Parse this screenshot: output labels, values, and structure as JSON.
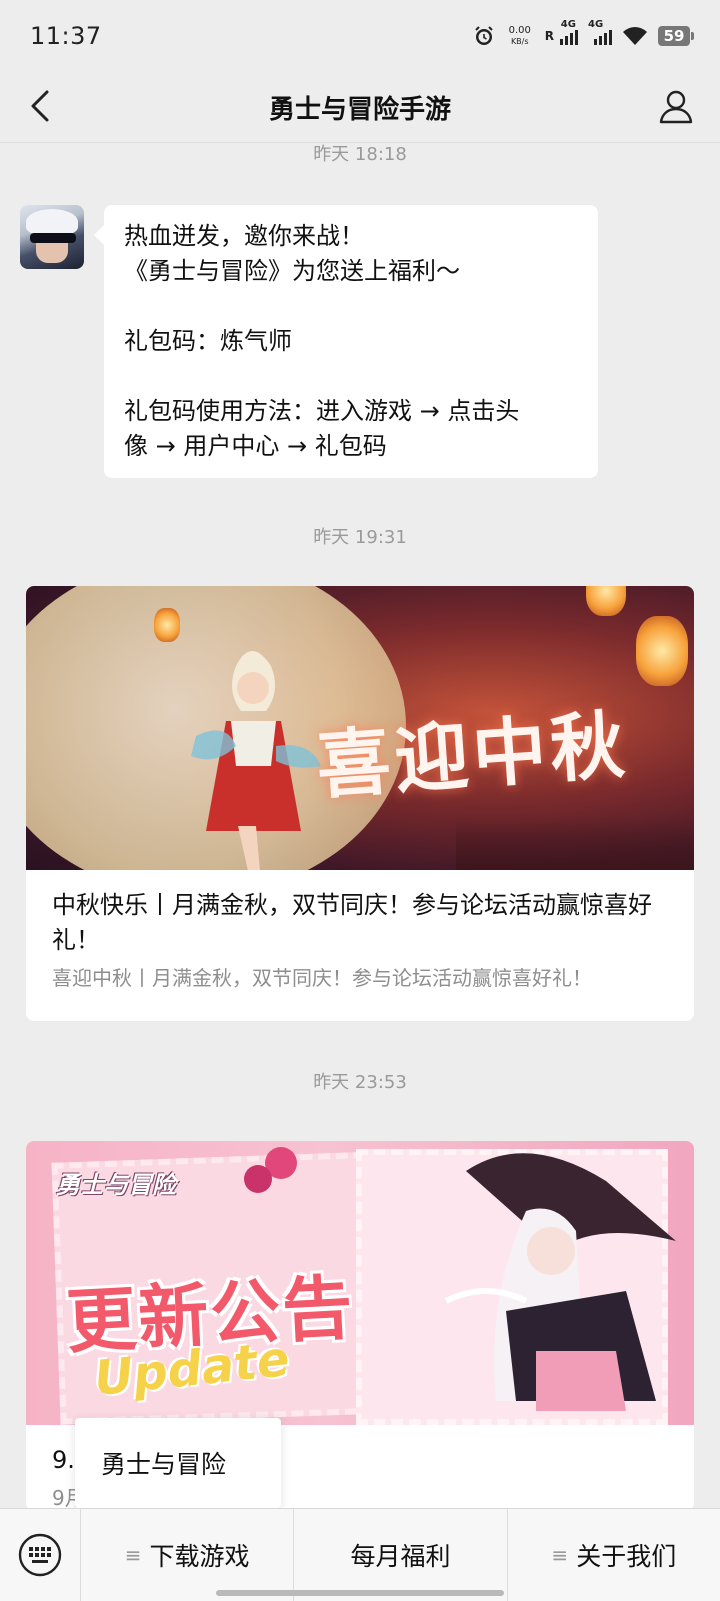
{
  "statusbar": {
    "time": "11:37",
    "netspeed_value": "0.00",
    "netspeed_unit": "KB/s",
    "roaming": "R",
    "sim1": "4G",
    "sim2": "4G",
    "battery": "59"
  },
  "header": {
    "title": "勇士与冒险手游"
  },
  "messages": [
    {
      "timestamp": "昨天 18:18",
      "lines": [
        "热血迸发，邀你来战！",
        "《勇士与冒险》为您送上福利～",
        "",
        "礼包码：炼气师",
        "",
        "礼包码使用方法：进入游戏 → 点击头",
        "像 → 用户中心 → 礼包码"
      ]
    },
    {
      "timestamp": "昨天 19:31",
      "banner_text": "喜迎中秋",
      "title": "中秋快乐丨月满金秋，双节同庆！参与论坛活动赢惊喜好礼！",
      "desc": "喜迎中秋丨月满金秋，双节同庆！参与论坛活动赢惊喜好礼！"
    },
    {
      "timestamp": "昨天 23:53",
      "banner_logo": "勇士与冒险",
      "banner_title": "更新公告",
      "banner_sub": "Update",
      "title_partial": "9.",
      "desc_partial": "9月"
    }
  ],
  "popup": {
    "label": "勇士与冒险"
  },
  "bottom_menu": {
    "items": [
      "下载游戏",
      "每月福利",
      "关于我们"
    ]
  },
  "colors": {
    "background": "#ededed",
    "bubble": "#ffffff",
    "timestamp": "#9a9a9a"
  }
}
